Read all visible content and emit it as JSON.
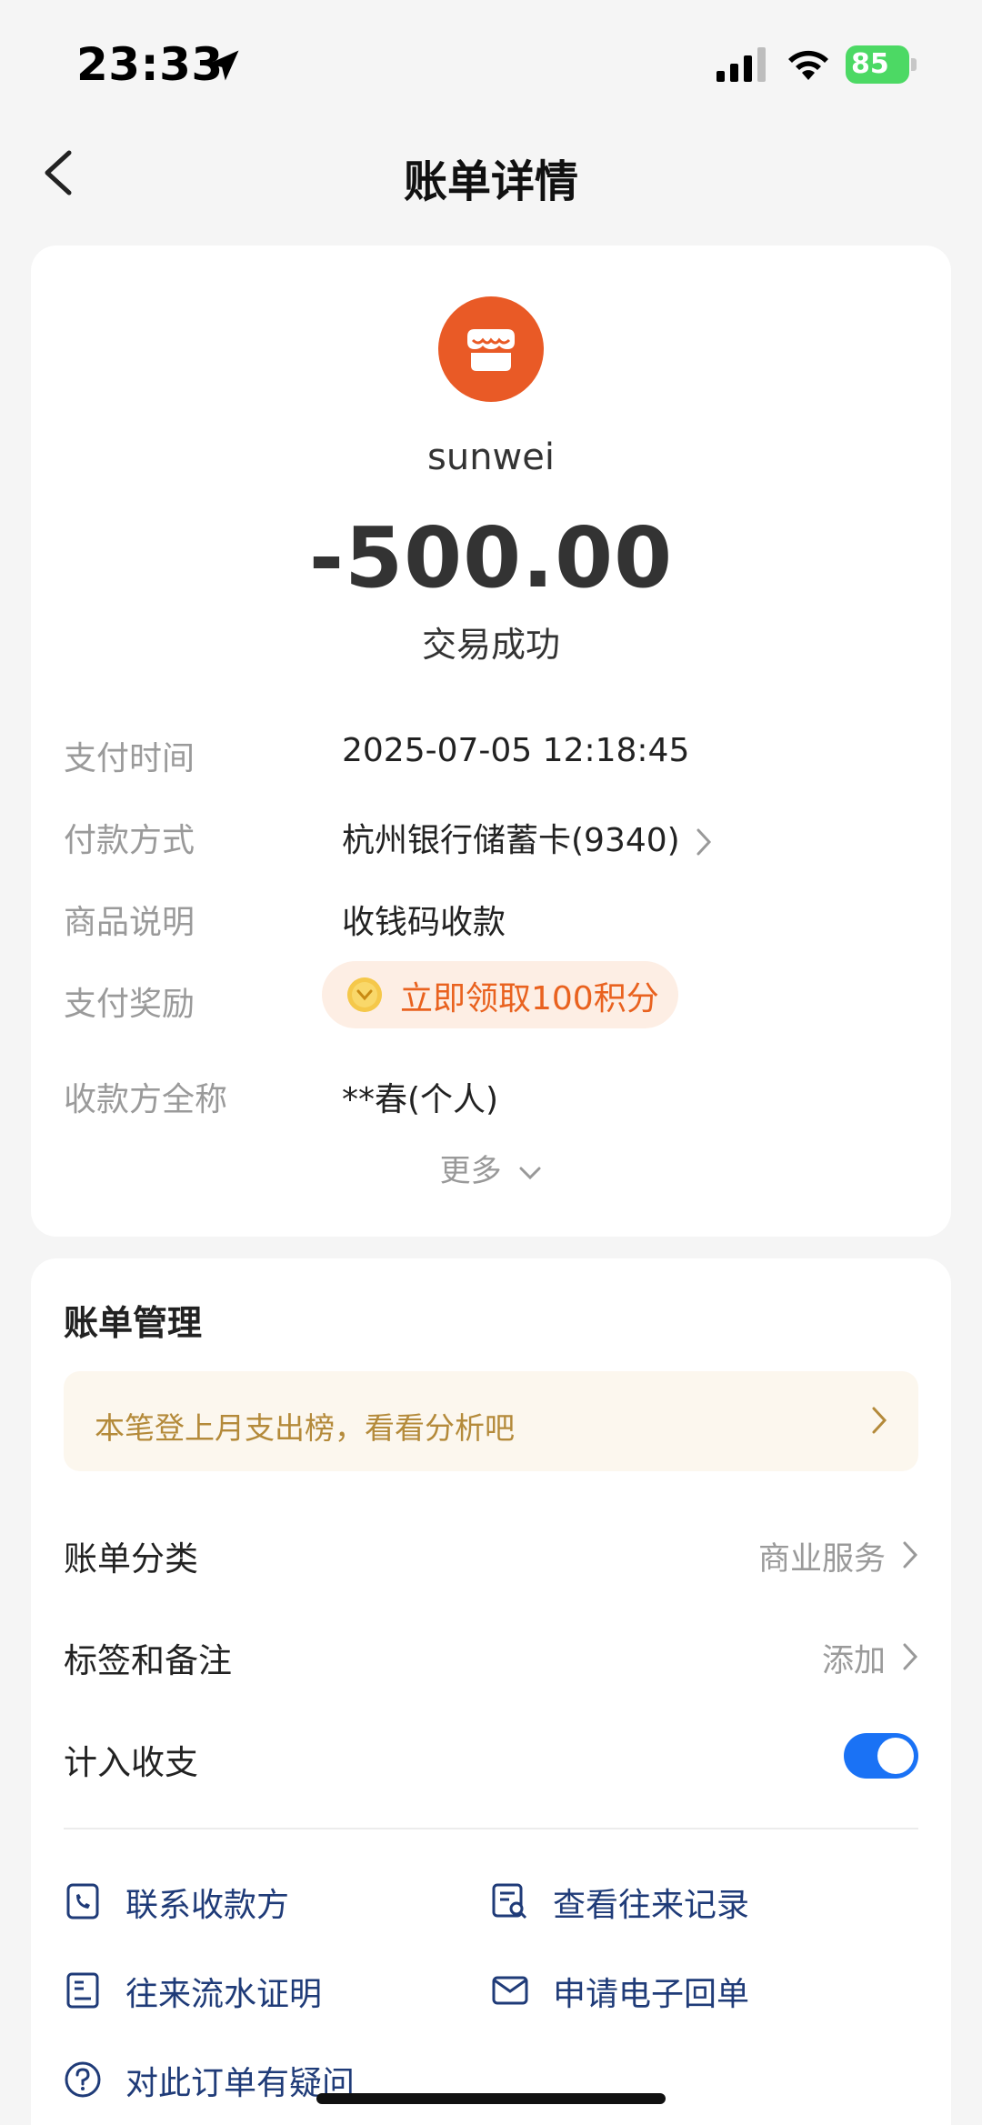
{
  "status_bar": {
    "time": "23:33",
    "battery": "85"
  },
  "nav": {
    "title": "账单详情",
    "back_icon": "chevron-left-icon"
  },
  "summary": {
    "merchant_icon": "store-icon",
    "merchant_name": "sunwei",
    "amount": "-500.00",
    "status": "交易成功",
    "accent_color": "#e95a26"
  },
  "details": {
    "pay_time_label": "支付时间",
    "pay_time_value": "2025-07-05 12:18:45",
    "pay_method_label": "付款方式",
    "pay_method_value": "杭州银行储蓄卡(9340)",
    "product_label": "商品说明",
    "product_value": "收钱码收款",
    "reward_label": "支付奖励",
    "reward_value": "立即领取100积分",
    "payee_label": "收款方全称",
    "payee_value": "**春(个人)",
    "more_label": "更多"
  },
  "management": {
    "title": "账单管理",
    "banner_text": "本笔登上月支出榜，看看分析吧",
    "category_label": "账单分类",
    "category_value": "商业服务",
    "tags_label": "标签和备注",
    "tags_value": "添加",
    "include_label": "计入收支",
    "include_enabled": true,
    "toggle_color": "#1a72f5"
  },
  "actions": [
    {
      "label": "联系收款方",
      "icon": "phone-contact-icon"
    },
    {
      "label": "查看往来记录",
      "icon": "records-search-icon"
    },
    {
      "label": "往来流水证明",
      "icon": "statement-icon"
    },
    {
      "label": "申请电子回单",
      "icon": "mail-icon"
    },
    {
      "label": "对此订单有疑问",
      "icon": "question-icon"
    }
  ]
}
